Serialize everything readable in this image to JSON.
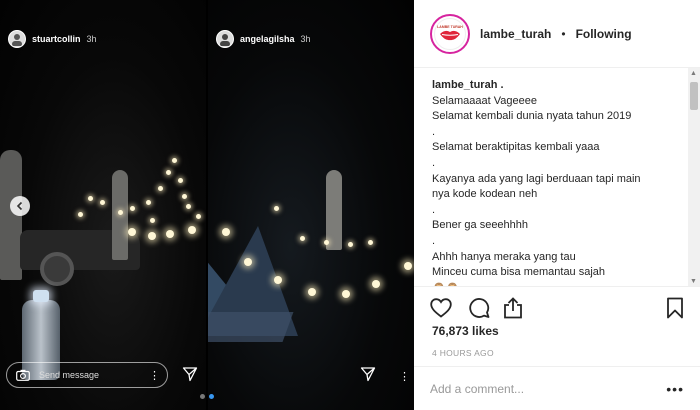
{
  "stories": [
    {
      "username": "stuartcollin",
      "time": "3h"
    },
    {
      "username": "angelagilsha",
      "time": "3h"
    }
  ],
  "story_input": {
    "placeholder": "Send message"
  },
  "post": {
    "username": "lambe_turah",
    "separator": "•",
    "follow_status": "Following",
    "caption_lines": [
      "lambe_turah .",
      "Selamaaaat Vageeee",
      "Selamat kembali dunia nyata tahun 2019",
      ".",
      "Selamat beraktipitas kembali yaaa",
      ".",
      "Kayanya ada yang lagi berduaan tapi main",
      "nya kode kodean neh",
      ".",
      "Bener ga seeehhhh",
      ".",
      "Ahhh hanya meraka yang tau",
      "Minceu cuma bisa memantau sajah",
      "🙈🙈"
    ],
    "likes": "76,873 likes",
    "time_ago": "4 HOURS AGO",
    "comment_placeholder": "Add a comment...",
    "more_label": "•••"
  },
  "logo_text": "LAMBE TURAH",
  "icons": {
    "nav": "chevron-left-icon",
    "camera": "camera-icon",
    "send": "send-icon",
    "like": "heart-icon",
    "comment": "comment-icon",
    "share": "share-icon",
    "save": "bookmark-icon"
  },
  "colors": {
    "accent": "#3897f0",
    "story_ring": "#d6249f",
    "text": "#262626",
    "muted": "#999999"
  }
}
